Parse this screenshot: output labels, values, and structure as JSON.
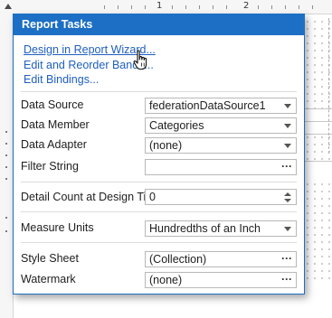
{
  "ruler": {
    "mark_1": "1",
    "mark_2": "2"
  },
  "panel": {
    "title": "Report Tasks",
    "links": [
      {
        "label": "Design in Report Wizard..."
      },
      {
        "label": "Edit and Reorder Bands..."
      },
      {
        "label": "Edit Bindings..."
      }
    ],
    "data_source": {
      "label": "Data Source",
      "value": "federationDataSource1"
    },
    "data_member": {
      "label": "Data Member",
      "value": "Categories"
    },
    "data_adapter": {
      "label": "Data Adapter",
      "value": "(none)"
    },
    "filter_string": {
      "label": "Filter String",
      "value": ""
    },
    "detail_count": {
      "label": "Detail Count at Design Time",
      "value": "0"
    },
    "measure_units": {
      "label": "Measure Units",
      "value": "Hundredths of an Inch"
    },
    "style_sheet": {
      "label": "Style Sheet",
      "value": "(Collection)"
    },
    "watermark": {
      "label": "Watermark",
      "value": "(none)"
    }
  },
  "icons": {
    "dropdown": "chevron-down-icon",
    "ellipsis": "ellipsis-icon",
    "spinner": "spin-icon",
    "cursor": "hand-pointer-icon"
  },
  "colors": {
    "header": "#1c6fc4",
    "link": "#1f5fbf"
  }
}
